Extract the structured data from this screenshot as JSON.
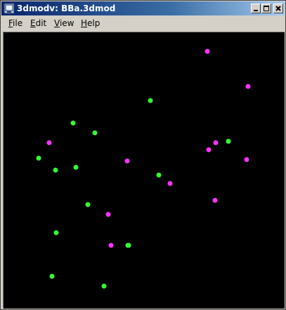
{
  "window": {
    "title": "3dmodv: BBa.3dmod"
  },
  "menu": {
    "items": [
      {
        "label": "File",
        "mnemonic": "F",
        "rest": "ile"
      },
      {
        "label": "Edit",
        "mnemonic": "E",
        "rest": "dit"
      },
      {
        "label": "View",
        "mnemonic": "V",
        "rest": "iew"
      },
      {
        "label": "Help",
        "mnemonic": "H",
        "rest": "elp"
      }
    ]
  },
  "viewer": {
    "background": "#000000",
    "green_color": "#33ff33",
    "magenta_color": "#ff33ff",
    "green_point_count": 15,
    "magenta_point_count": 13
  },
  "icons": [
    "app-3dmod-icon",
    "minimize-icon",
    "maximize-icon",
    "close-icon"
  ]
}
